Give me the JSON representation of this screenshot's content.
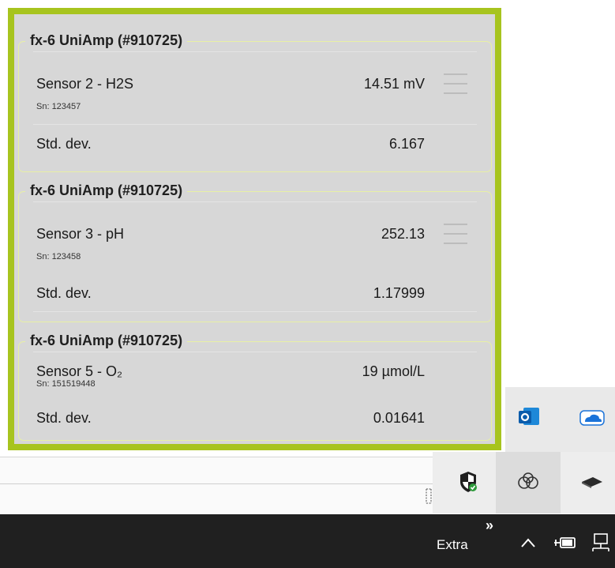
{
  "groups": [
    {
      "title": "fx-6 UniAmp (#910725)",
      "sensor": "Sensor 2 - H2S",
      "sn": "Sn: 123457",
      "value": "14.51 mV",
      "std_label": "Std. dev.",
      "std_value": "6.167",
      "has_menu": true
    },
    {
      "title": "fx-6 UniAmp (#910725)",
      "sensor": "Sensor 3 - pH",
      "sn": "Sn: 123458",
      "value": "252.13",
      "std_label": "Std. dev.",
      "std_value": "1.17999",
      "has_menu": true
    },
    {
      "title": "fx-6 UniAmp (#910725)",
      "sensor": "Sensor 5 - O₂",
      "sn": "Sn: 151519448",
      "value": "19 µmol/L",
      "std_label": "Std. dev.",
      "std_value": "0.01641",
      "has_menu": false
    }
  ],
  "taskbar": {
    "label": "Extra",
    "overflow_glyph": "»",
    "chevron_glyph": "^"
  },
  "colors": {
    "panel_border": "#a7c41e",
    "panel_bg": "#d7d7d7",
    "taskbar_bg": "#202020"
  },
  "tray_icons": [
    "outlook-icon",
    "onedrive-icon",
    "windows-security-icon",
    "linked-circles-app-icon",
    "usb-device-icon",
    "power-plug-icon",
    "network-icon"
  ]
}
